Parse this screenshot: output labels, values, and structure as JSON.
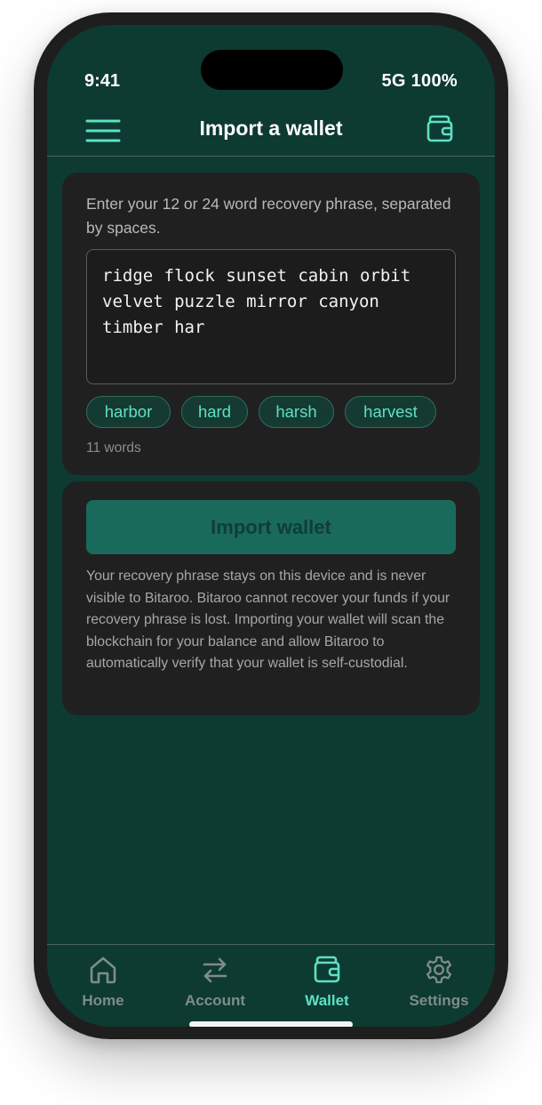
{
  "status": {
    "time": "9:41",
    "network_battery": "5G 100%"
  },
  "header": {
    "title": "Import a wallet",
    "menu_icon": "hamburger-menu-icon",
    "wallet_icon": "wallet-icon"
  },
  "phrase": {
    "instructions": "Enter your 12 or 24 word recovery phrase, separated by spaces.",
    "value": "ridge flock sunset cabin orbit velvet puzzle mirror canyon timber har",
    "suggestions": [
      "harbor",
      "hard",
      "harsh",
      "harvest"
    ],
    "word_count": "11 words"
  },
  "import": {
    "button_label": "Import wallet",
    "disclaimer": "Your recovery phrase stays on this device and is never visible to Bitaroo. Bitaroo cannot recover your funds if your recovery phrase is lost. Importing your wallet will scan the blockchain for your balance and allow Bitaroo to automatically verify that your wallet is self-custodial."
  },
  "tabs": [
    {
      "label": "Home",
      "icon": "home-icon",
      "active": false
    },
    {
      "label": "Account",
      "icon": "transfer-arrows-icon",
      "active": false
    },
    {
      "label": "Wallet",
      "icon": "wallet-icon",
      "active": true
    },
    {
      "label": "Settings",
      "icon": "gear-icon",
      "active": false
    }
  ],
  "colors": {
    "background": "#0d3a31",
    "card": "#202020",
    "accent": "#5ce1c4",
    "button": "#1a6a5c",
    "inactive_tab": "#7f8c88"
  }
}
